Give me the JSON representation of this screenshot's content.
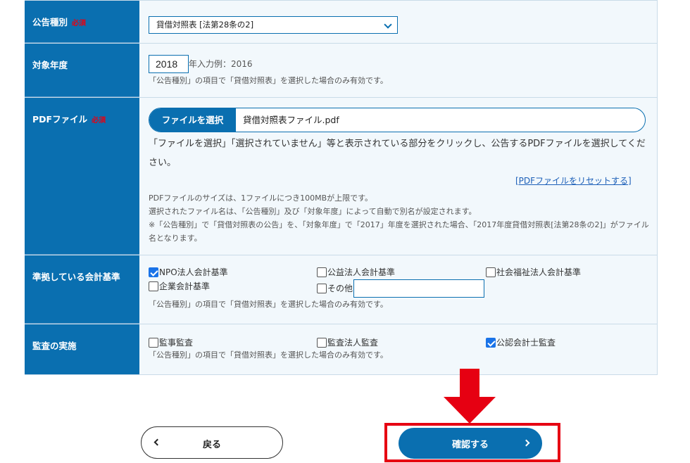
{
  "form": {
    "notice_type": {
      "label": "公告種別",
      "required": "必須",
      "selected": "貸借対照表 [法第28条の2]"
    },
    "fiscal_year": {
      "label": "対象年度",
      "value": "2018",
      "hint": "年入力例：2016",
      "note": "「公告種別」の項目で「貸借対照表」を選択した場合のみ有効です。"
    },
    "pdf_file": {
      "label": "PDFファイル",
      "required": "必須",
      "button": "ファイルを選択",
      "file_name": "貸借対照表ファイル.pdf",
      "instruction": "「ファイルを選択」「選択されていません」等と表示されている部分をクリックし、公告するPDFファイルを選択してください。",
      "reset_link": "[PDFファイルをリセットする]",
      "notes": [
        "PDFファイルのサイズは、1ファイルにつき100MBが上限です。",
        "選択されたファイル名は、「公告種別」及び「対象年度」によって自動で別名が設定されます。",
        "※「公告種別」で「貸借対照表の公告」を、「対象年度」で「2017」年度を選択された場合、「2017年度貸借対照表[法第28条の2]」がファイル名となります。"
      ]
    },
    "accounting_standard": {
      "label": "準拠している会計基準",
      "options": [
        {
          "label": "NPO法人会計基準",
          "checked": true
        },
        {
          "label": "公益法人会計基準",
          "checked": false
        },
        {
          "label": "社会福祉法人会計基準",
          "checked": false
        },
        {
          "label": "企業会計基準",
          "checked": false
        },
        {
          "label": "その他",
          "checked": false
        }
      ],
      "other_value": "",
      "note": "「公告種別」の項目で「貸借対照表」を選択した場合のみ有効です。"
    },
    "audit": {
      "label": "監査の実施",
      "options": [
        {
          "label": "監事監査",
          "checked": false
        },
        {
          "label": "監査法人監査",
          "checked": false
        },
        {
          "label": "公認会計士監査",
          "checked": true
        }
      ],
      "note": "「公告種別」の項目で「貸借対照表」を選択した場合のみ有効です。"
    }
  },
  "buttons": {
    "back": "戻る",
    "confirm": "確認する"
  },
  "colors": {
    "primary": "#0a6fb0",
    "highlight": "#e60012",
    "checkbox": "#1a73e8"
  }
}
